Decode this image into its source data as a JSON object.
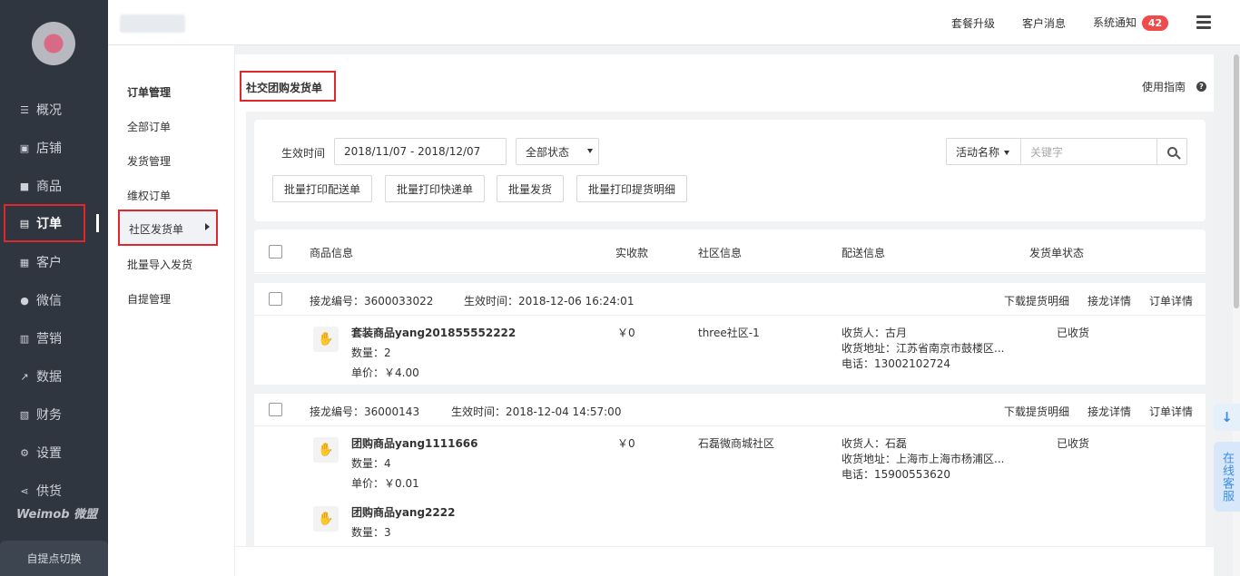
{
  "sidebar": {
    "items": [
      {
        "label": "概况",
        "icon": "list-icon"
      },
      {
        "label": "店铺",
        "icon": "store-icon"
      },
      {
        "label": "商品",
        "icon": "goods-icon"
      },
      {
        "label": "订单",
        "icon": "order-icon",
        "active": true
      },
      {
        "label": "客户",
        "icon": "customer-icon"
      },
      {
        "label": "微信",
        "icon": "wechat-icon"
      },
      {
        "label": "营销",
        "icon": "bar-chart-icon"
      },
      {
        "label": "数据",
        "icon": "line-chart-icon"
      },
      {
        "label": "财务",
        "icon": "finance-icon"
      },
      {
        "label": "设置",
        "icon": "gear-icon"
      },
      {
        "label": "供货",
        "icon": "share-icon"
      }
    ],
    "brand": "Weimob 微盟",
    "switch_label": "自提点切换"
  },
  "topbar": {
    "upgrade": "套餐升级",
    "customer_msg": "客户消息",
    "system_notice": "系统通知",
    "notice_count": "42"
  },
  "submenu": {
    "title": "订单管理",
    "items": [
      "全部订单",
      "发货管理",
      "维权订单",
      "社区发货单",
      "批量导入发货",
      "自提管理"
    ]
  },
  "page": {
    "title": "社交团购发货单",
    "guide": "使用指南",
    "guide_icon": "?"
  },
  "filter": {
    "time_label": "生效时间",
    "date_range": "2018/11/07 - 2018/12/07",
    "status": "全部状态",
    "search_field": "活动名称",
    "search_placeholder": "关键字",
    "buttons": [
      "批量打印配送单",
      "批量打印快递单",
      "批量发货",
      "批量打印提货明细"
    ]
  },
  "table": {
    "headers": [
      "商品信息",
      "实收款",
      "社区信息",
      "配送信息",
      "发货单状态"
    ],
    "orders": [
      {
        "jielong_label": "接龙编号：3600033022",
        "time_label": "生效时间：2018-12-06 16:24:01",
        "actions": [
          "下载提货明细",
          "接龙详情",
          "订单详情"
        ],
        "products": [
          {
            "name": "套装商品yang201855552222",
            "qty": "数量：2",
            "price": "单价：￥4.00"
          }
        ],
        "amount": "￥0",
        "community": "three社区-1",
        "receiver": "收货人：古月",
        "address": "收货地址：江苏省南京市鼓楼区...",
        "phone": "电话：13002102724",
        "status": "已收货"
      },
      {
        "jielong_label": "接龙编号：36000143",
        "time_label": "生效时间：2018-12-04 14:57:00",
        "actions": [
          "下载提货明细",
          "接龙详情",
          "订单详情"
        ],
        "products": [
          {
            "name": "团购商品yang1111666",
            "qty": "数量：4",
            "price": "单价：￥0.01"
          },
          {
            "name": "团购商品yang2222",
            "qty": "数量：3"
          }
        ],
        "amount": "￥0",
        "community": "石磊微商城社区",
        "receiver": "收货人：石磊",
        "address": "收货地址：上海市上海市杨浦区...",
        "phone": "电话：15900553620",
        "status": "已收货"
      }
    ]
  },
  "floating": {
    "download_icon": "↓",
    "online_service": "在线客服"
  },
  "colors": {
    "sidebar_bg": "#2f3640",
    "highlight_red": "#e0262e",
    "badge_red": "#f04b4b",
    "accent_blue": "#3a8ee6"
  }
}
